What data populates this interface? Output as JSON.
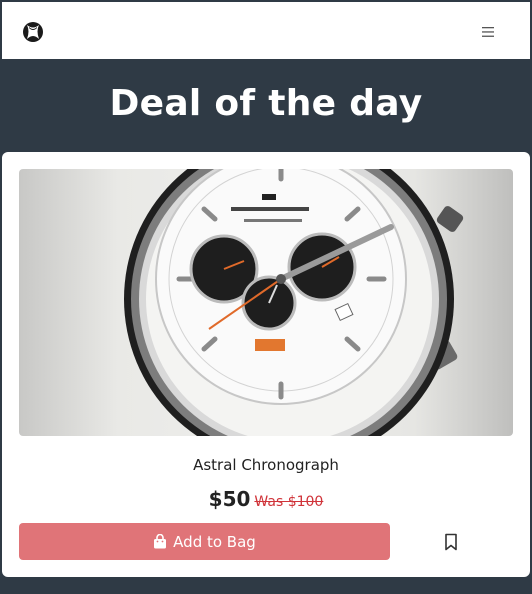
{
  "nav": {
    "logo_icon": "xbox-logo-icon",
    "menu_icon": "hamburger-menu-icon"
  },
  "hero": {
    "title": "Deal of the day"
  },
  "product": {
    "image_alt": "Astral Chronograph watch",
    "name": "Astral Chronograph",
    "price": "$50",
    "was_price": "Was $100",
    "add_label": "Add to Bag",
    "add_icon": "shopping-bag-icon",
    "bookmark_icon": "bookmark-icon"
  },
  "colors": {
    "header_bg": "#2f3a45",
    "button_bg": "#e07478",
    "was_price": "#d0343a"
  }
}
